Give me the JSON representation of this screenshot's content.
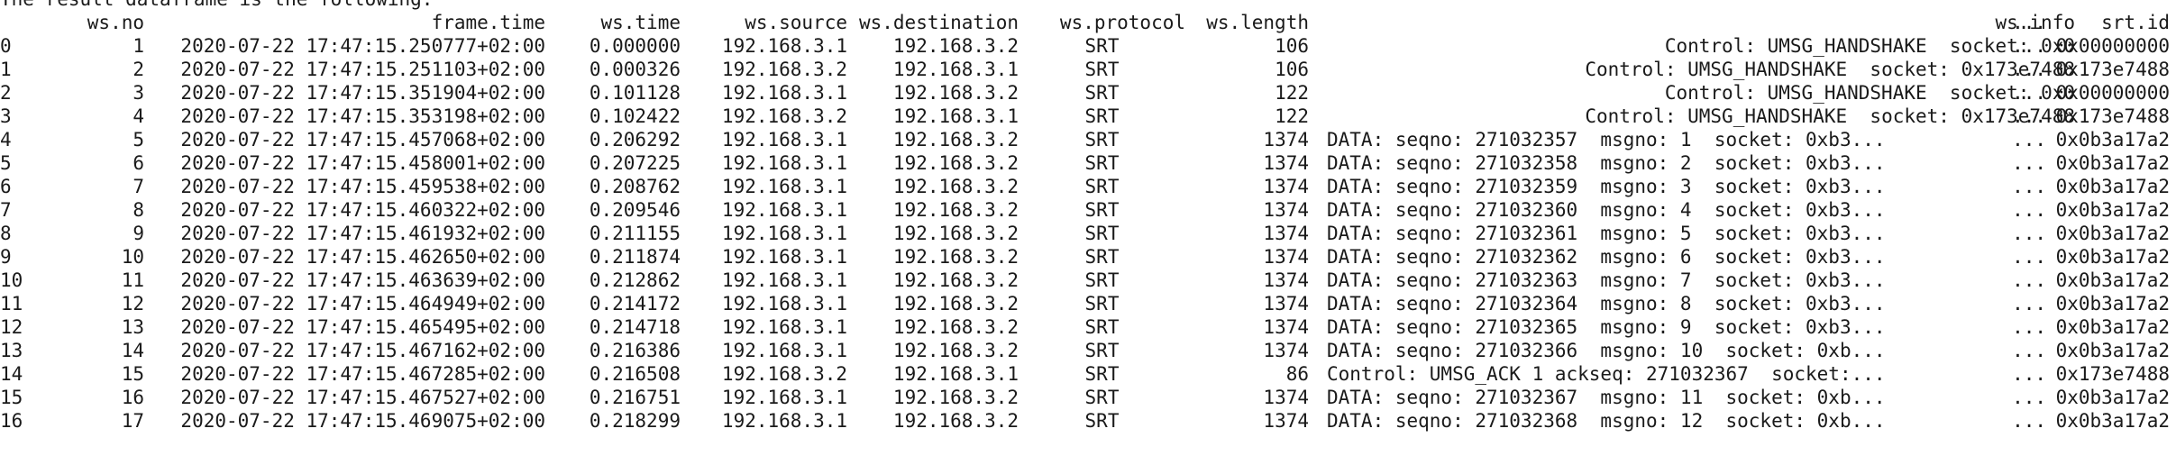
{
  "caption": "The result dataframe is the following:",
  "table": {
    "headers": {
      "idx": "",
      "no": "ws.no",
      "frame_time": "frame.time",
      "ws_time": "ws.time",
      "source": "ws.source",
      "destination": "ws.destination",
      "protocol": "ws.protocol",
      "length": "ws.length",
      "info": "ws.info",
      "ellipsis": "...",
      "srt_id": "srt.id"
    },
    "rows": [
      {
        "idx": "0",
        "no": "1",
        "frame_time": "2020-07-22 17:47:15.250777+02:00",
        "ws_time": "0.000000",
        "source": "192.168.3.1",
        "destination": "192.168.3.2",
        "protocol": "SRT",
        "length": "106",
        "info": "Control: UMSG_HANDSHAKE  socket: 0x0",
        "info_align": "right",
        "ellipsis": "...",
        "srt_id": "0x00000000"
      },
      {
        "idx": "1",
        "no": "2",
        "frame_time": "2020-07-22 17:47:15.251103+02:00",
        "ws_time": "0.000326",
        "source": "192.168.3.2",
        "destination": "192.168.3.1",
        "protocol": "SRT",
        "length": "106",
        "info": "Control: UMSG_HANDSHAKE  socket: 0x173e7488",
        "info_align": "right",
        "ellipsis": "...",
        "srt_id": "0x173e7488"
      },
      {
        "idx": "2",
        "no": "3",
        "frame_time": "2020-07-22 17:47:15.351904+02:00",
        "ws_time": "0.101128",
        "source": "192.168.3.1",
        "destination": "192.168.3.2",
        "protocol": "SRT",
        "length": "122",
        "info": "Control: UMSG_HANDSHAKE  socket: 0x0",
        "info_align": "right",
        "ellipsis": "...",
        "srt_id": "0x00000000"
      },
      {
        "idx": "3",
        "no": "4",
        "frame_time": "2020-07-22 17:47:15.353198+02:00",
        "ws_time": "0.102422",
        "source": "192.168.3.2",
        "destination": "192.168.3.1",
        "protocol": "SRT",
        "length": "122",
        "info": "Control: UMSG_HANDSHAKE  socket: 0x173e7488",
        "info_align": "right",
        "ellipsis": "...",
        "srt_id": "0x173e7488"
      },
      {
        "idx": "4",
        "no": "5",
        "frame_time": "2020-07-22 17:47:15.457068+02:00",
        "ws_time": "0.206292",
        "source": "192.168.3.1",
        "destination": "192.168.3.2",
        "protocol": "SRT",
        "length": "1374",
        "info": "DATA: seqno: 271032357  msgno: 1  socket: 0xb3...",
        "info_align": "left",
        "ellipsis": "...",
        "srt_id": "0x0b3a17a2"
      },
      {
        "idx": "5",
        "no": "6",
        "frame_time": "2020-07-22 17:47:15.458001+02:00",
        "ws_time": "0.207225",
        "source": "192.168.3.1",
        "destination": "192.168.3.2",
        "protocol": "SRT",
        "length": "1374",
        "info": "DATA: seqno: 271032358  msgno: 2  socket: 0xb3...",
        "info_align": "left",
        "ellipsis": "...",
        "srt_id": "0x0b3a17a2"
      },
      {
        "idx": "6",
        "no": "7",
        "frame_time": "2020-07-22 17:47:15.459538+02:00",
        "ws_time": "0.208762",
        "source": "192.168.3.1",
        "destination": "192.168.3.2",
        "protocol": "SRT",
        "length": "1374",
        "info": "DATA: seqno: 271032359  msgno: 3  socket: 0xb3...",
        "info_align": "left",
        "ellipsis": "...",
        "srt_id": "0x0b3a17a2"
      },
      {
        "idx": "7",
        "no": "8",
        "frame_time": "2020-07-22 17:47:15.460322+02:00",
        "ws_time": "0.209546",
        "source": "192.168.3.1",
        "destination": "192.168.3.2",
        "protocol": "SRT",
        "length": "1374",
        "info": "DATA: seqno: 271032360  msgno: 4  socket: 0xb3...",
        "info_align": "left",
        "ellipsis": "...",
        "srt_id": "0x0b3a17a2"
      },
      {
        "idx": "8",
        "no": "9",
        "frame_time": "2020-07-22 17:47:15.461932+02:00",
        "ws_time": "0.211155",
        "source": "192.168.3.1",
        "destination": "192.168.3.2",
        "protocol": "SRT",
        "length": "1374",
        "info": "DATA: seqno: 271032361  msgno: 5  socket: 0xb3...",
        "info_align": "left",
        "ellipsis": "...",
        "srt_id": "0x0b3a17a2"
      },
      {
        "idx": "9",
        "no": "10",
        "frame_time": "2020-07-22 17:47:15.462650+02:00",
        "ws_time": "0.211874",
        "source": "192.168.3.1",
        "destination": "192.168.3.2",
        "protocol": "SRT",
        "length": "1374",
        "info": "DATA: seqno: 271032362  msgno: 6  socket: 0xb3...",
        "info_align": "left",
        "ellipsis": "...",
        "srt_id": "0x0b3a17a2"
      },
      {
        "idx": "10",
        "no": "11",
        "frame_time": "2020-07-22 17:47:15.463639+02:00",
        "ws_time": "0.212862",
        "source": "192.168.3.1",
        "destination": "192.168.3.2",
        "protocol": "SRT",
        "length": "1374",
        "info": "DATA: seqno: 271032363  msgno: 7  socket: 0xb3...",
        "info_align": "left",
        "ellipsis": "...",
        "srt_id": "0x0b3a17a2"
      },
      {
        "idx": "11",
        "no": "12",
        "frame_time": "2020-07-22 17:47:15.464949+02:00",
        "ws_time": "0.214172",
        "source": "192.168.3.1",
        "destination": "192.168.3.2",
        "protocol": "SRT",
        "length": "1374",
        "info": "DATA: seqno: 271032364  msgno: 8  socket: 0xb3...",
        "info_align": "left",
        "ellipsis": "...",
        "srt_id": "0x0b3a17a2"
      },
      {
        "idx": "12",
        "no": "13",
        "frame_time": "2020-07-22 17:47:15.465495+02:00",
        "ws_time": "0.214718",
        "source": "192.168.3.1",
        "destination": "192.168.3.2",
        "protocol": "SRT",
        "length": "1374",
        "info": "DATA: seqno: 271032365  msgno: 9  socket: 0xb3...",
        "info_align": "left",
        "ellipsis": "...",
        "srt_id": "0x0b3a17a2"
      },
      {
        "idx": "13",
        "no": "14",
        "frame_time": "2020-07-22 17:47:15.467162+02:00",
        "ws_time": "0.216386",
        "source": "192.168.3.1",
        "destination": "192.168.3.2",
        "protocol": "SRT",
        "length": "1374",
        "info": "DATA: seqno: 271032366  msgno: 10  socket: 0xb...",
        "info_align": "left",
        "ellipsis": "...",
        "srt_id": "0x0b3a17a2"
      },
      {
        "idx": "14",
        "no": "15",
        "frame_time": "2020-07-22 17:47:15.467285+02:00",
        "ws_time": "0.216508",
        "source": "192.168.3.2",
        "destination": "192.168.3.1",
        "protocol": "SRT",
        "length": "86",
        "info": "Control: UMSG_ACK 1 ackseq: 271032367  socket:...",
        "info_align": "left",
        "ellipsis": "...",
        "srt_id": "0x173e7488"
      },
      {
        "idx": "15",
        "no": "16",
        "frame_time": "2020-07-22 17:47:15.467527+02:00",
        "ws_time": "0.216751",
        "source": "192.168.3.1",
        "destination": "192.168.3.2",
        "protocol": "SRT",
        "length": "1374",
        "info": "DATA: seqno: 271032367  msgno: 11  socket: 0xb...",
        "info_align": "left",
        "ellipsis": "...",
        "srt_id": "0x0b3a17a2"
      },
      {
        "idx": "16",
        "no": "17",
        "frame_time": "2020-07-22 17:47:15.469075+02:00",
        "ws_time": "0.218299",
        "source": "192.168.3.1",
        "destination": "192.168.3.2",
        "protocol": "SRT",
        "length": "1374",
        "info": "DATA: seqno: 271032368  msgno: 12  socket: 0xb...",
        "info_align": "left",
        "ellipsis": "...",
        "srt_id": "0x0b3a17a2"
      }
    ]
  }
}
